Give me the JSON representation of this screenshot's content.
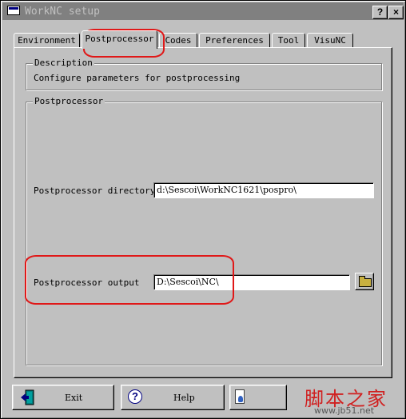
{
  "window": {
    "title": "WorkNC setup",
    "help_glyph": "?",
    "close_glyph": "×"
  },
  "tabs": [
    {
      "label": "Environment",
      "active": false
    },
    {
      "label": "Postprocessor",
      "active": true
    },
    {
      "label": "Codes",
      "active": false
    },
    {
      "label": "Preferences",
      "active": false
    },
    {
      "label": "Tool",
      "active": false
    },
    {
      "label": "VisuNC",
      "active": false
    }
  ],
  "description": {
    "legend": "Description",
    "text": "Configure parameters for postprocessing"
  },
  "postprocessor": {
    "legend": "Postprocessor",
    "directory_label": "Postprocessor directory",
    "directory_value": "d:\\Sescoi\\WorkNC1621\\pospro\\",
    "output_label": "Postprocessor output",
    "output_value": "D:\\Sescoi\\NC\\",
    "browse_icon": "folder-icon"
  },
  "buttons": {
    "exit_label": "Exit",
    "help_label": "Help"
  },
  "watermark": {
    "text": "脚本之家",
    "url": "www.jb51.net"
  },
  "colors": {
    "title_bar": "#808080",
    "face": "#c0c0c0",
    "annotation": "#e01818"
  }
}
